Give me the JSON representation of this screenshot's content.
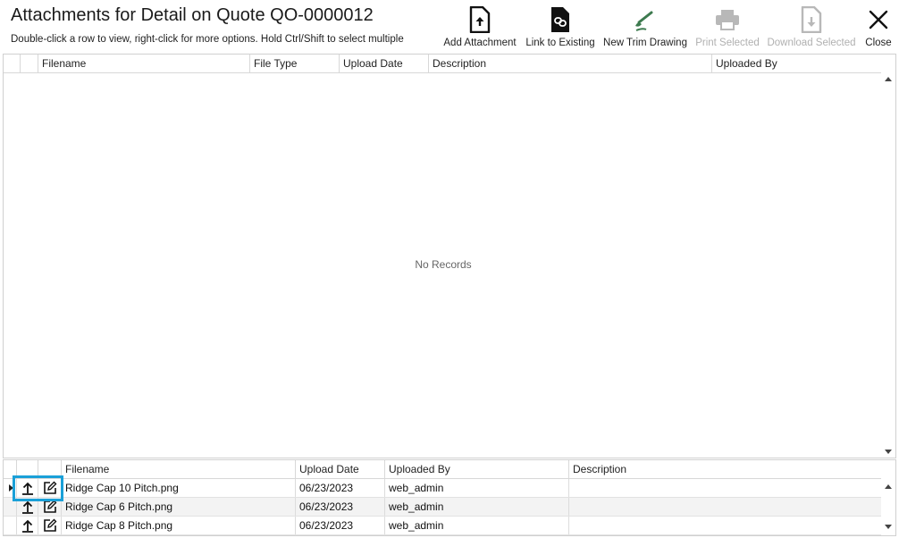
{
  "header": {
    "title": "Attachments for Detail on Quote QO-0000012",
    "subtitle": "Double-click a row to view, right-click for more options. Hold Ctrl/Shift to select multiple"
  },
  "toolbar": {
    "add_attachment": "Add Attachment",
    "link_existing": "Link to Existing",
    "new_trim_drawing": "New Trim Drawing",
    "print_selected": "Print Selected",
    "download_selected": "Download Selected",
    "close": "Close"
  },
  "top_grid": {
    "columns": [
      "Filename",
      "File Type",
      "Upload Date",
      "Description",
      "Uploaded By"
    ],
    "empty_text": "No Records"
  },
  "bottom_grid": {
    "columns": [
      "Filename",
      "Upload Date",
      "Uploaded By",
      "Description"
    ],
    "rows": [
      {
        "filename": "Ridge Cap 10 Pitch.png",
        "upload_date": "06/23/2023",
        "uploaded_by": "web_admin",
        "description": ""
      },
      {
        "filename": "Ridge Cap 6 Pitch.png",
        "upload_date": "06/23/2023",
        "uploaded_by": "web_admin",
        "description": ""
      },
      {
        "filename": "Ridge Cap 8 Pitch.png",
        "upload_date": "06/23/2023",
        "uploaded_by": "web_admin",
        "description": ""
      }
    ]
  },
  "icons": {
    "upload": "upload-icon",
    "edit": "edit-icon",
    "close": "close-icon",
    "add_attachment": "file-upload-icon",
    "link": "file-link-icon",
    "trim": "trim-drawing-icon",
    "print": "printer-icon",
    "download": "file-download-icon"
  },
  "colors": {
    "highlight": "#1aa0d8",
    "trim_icon": "#3d7a4f",
    "disabled": "#b0b0b0"
  }
}
